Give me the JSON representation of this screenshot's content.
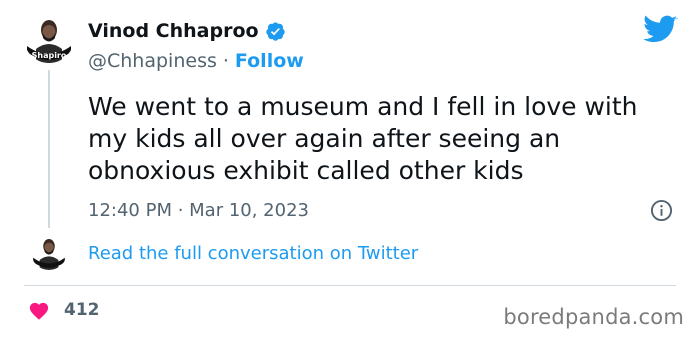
{
  "author": {
    "display_name": "Vinod Chhaproo",
    "handle": "@Chhapiness",
    "separator": "·",
    "follow_label": "Follow",
    "avatar_text": "Shapiro"
  },
  "tweet": {
    "text": "We went to a museum and I fell in love with\nmy kids all over again after seeing an\nobnoxious exhibit called other kids",
    "timestamp": "12:40 PM · Mar 10, 2023"
  },
  "conversation": {
    "link_label": "Read the full conversation on Twitter"
  },
  "engagement": {
    "like_count": "412"
  },
  "watermark": "boredpanda.com",
  "colors": {
    "accent": "#1d9bf0",
    "like": "#f91880",
    "muted": "#536471"
  },
  "icons": {
    "verified": "verified-badge-icon",
    "twitter": "twitter-bird-icon",
    "info": "info-icon",
    "like": "heart-icon"
  }
}
